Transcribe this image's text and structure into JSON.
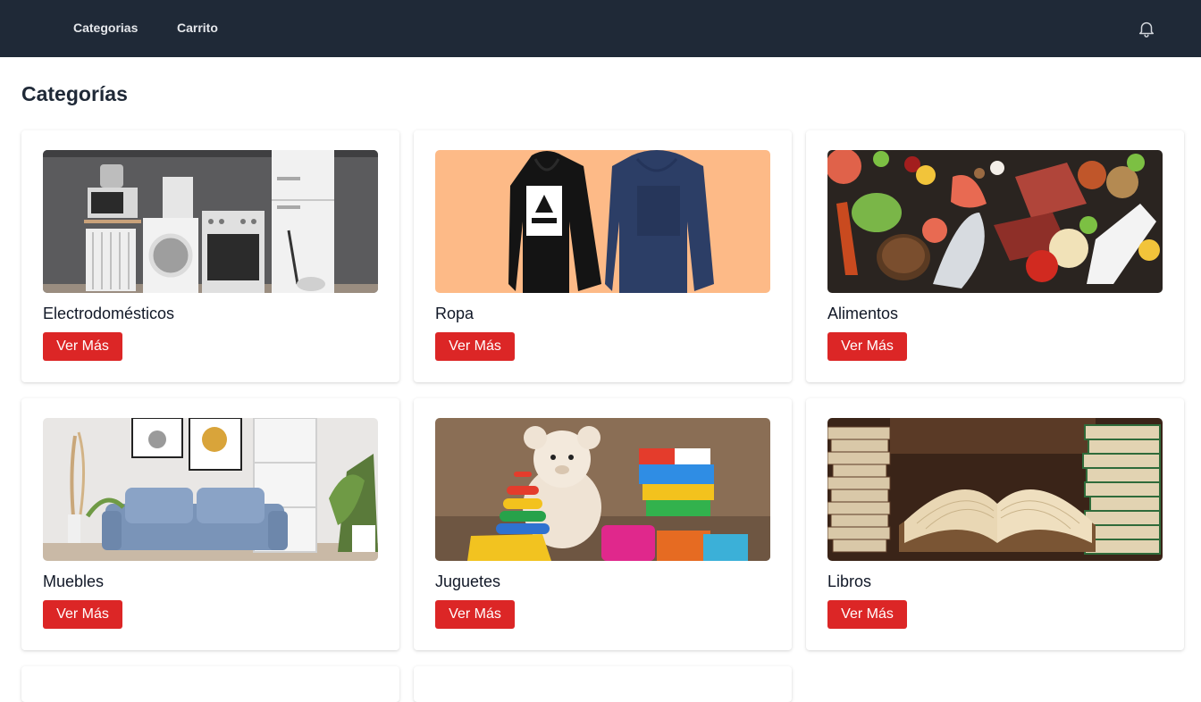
{
  "nav": {
    "links": [
      "Categorias",
      "Carrito"
    ],
    "notification_icon": "bell-icon"
  },
  "page": {
    "title": "Categorías"
  },
  "categories": [
    {
      "name": "Electrodomésticos",
      "button": "Ver Más",
      "image": "appliances-photo"
    },
    {
      "name": "Ropa",
      "button": "Ver Más",
      "image": "hoodies-photo"
    },
    {
      "name": "Alimentos",
      "button": "Ver Más",
      "image": "food-photo"
    },
    {
      "name": "Muebles",
      "button": "Ver Más",
      "image": "living-room-photo"
    },
    {
      "name": "Juguetes",
      "button": "Ver Más",
      "image": "toys-photo"
    },
    {
      "name": "Libros",
      "button": "Ver Más",
      "image": "books-photo"
    }
  ],
  "colors": {
    "nav_bg": "#1f2937",
    "button_bg": "#dc2626",
    "ropa_bg": "#fdba87"
  }
}
